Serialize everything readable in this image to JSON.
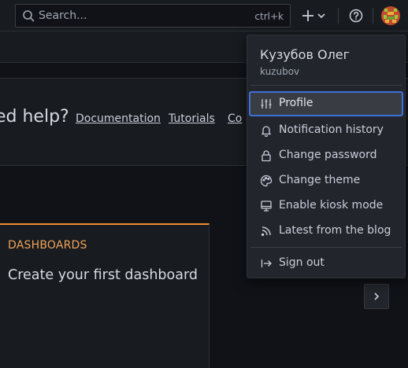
{
  "topbar": {
    "search_placeholder": "Search...",
    "search_shortcut": "ctrl+k",
    "icons": [
      "search-icon",
      "plus-icon",
      "chevron-down-icon",
      "help-icon",
      "avatar"
    ]
  },
  "help_banner": {
    "heading": "ed help?",
    "links": [
      "Documentation",
      "Tutorials",
      "Co"
    ]
  },
  "card": {
    "category": "DASHBOARDS",
    "title": "Create your first dashboard"
  },
  "user_menu": {
    "name": "Кузубов Олег",
    "login": "kuzubov",
    "items": [
      {
        "label": "Profile",
        "icon": "sliders-icon",
        "active": true
      },
      {
        "label": "Notification history",
        "icon": "bell-icon"
      },
      {
        "label": "Change password",
        "icon": "lock-icon"
      },
      {
        "label": "Change theme",
        "icon": "palette-icon"
      },
      {
        "label": "Enable kiosk mode",
        "icon": "monitor-icon"
      },
      {
        "label": "Latest from the blog",
        "icon": "rss-icon"
      }
    ],
    "signout_label": "Sign out"
  },
  "colors": {
    "accent_border": "#3d71d9",
    "card_accent": "#f08c30"
  }
}
